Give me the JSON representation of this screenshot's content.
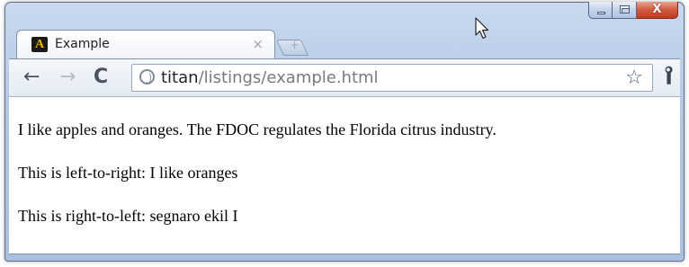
{
  "tab": {
    "title": "Example",
    "close_glyph": "×",
    "favicon": "A"
  },
  "new_tab": {
    "glyph": "+"
  },
  "window_controls": {
    "minimize": "minimize",
    "maximize": "maximize",
    "close_glyph": "X"
  },
  "toolbar": {
    "back_glyph": "←",
    "forward_glyph": "→",
    "reload_glyph": "C",
    "url_host": "titan",
    "url_path": "/listings/example.html",
    "star_glyph": "☆",
    "wrench_glyph": "🔧"
  },
  "content": {
    "paragraphs": [
      "I like apples and oranges. The FDOC regulates the Florida citrus industry.",
      "This is left-to-right: I like oranges",
      "This is right-to-left: segnaro ekil I"
    ]
  },
  "icons": {
    "favicon": "app-favicon-icon",
    "globe": "globe-icon",
    "star": "star-icon",
    "wrench": "wrench-icon",
    "cursor": "mouse-cursor-icon"
  },
  "colors": {
    "frame": "#b3c8e6",
    "close_button": "#c13a1e",
    "url_path": "#7a7a7a"
  }
}
